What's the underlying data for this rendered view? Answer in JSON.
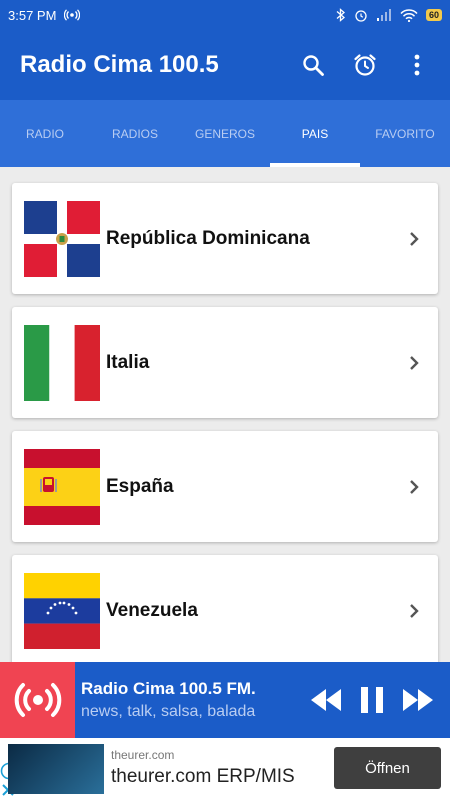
{
  "status_bar": {
    "time": "3:57 PM",
    "battery": "60"
  },
  "app_bar": {
    "title": "Radio Cima 100.5",
    "icons": [
      "search-icon",
      "alarm-icon",
      "more-vert-icon"
    ]
  },
  "tabs": [
    {
      "label": "RADIO"
    },
    {
      "label": "RADIOS"
    },
    {
      "label": "GENEROS"
    },
    {
      "label": "PAIS",
      "active": true
    },
    {
      "label": "FAVORITO"
    }
  ],
  "countries": [
    {
      "name": "República Dominicana",
      "flag": "dominican-republic-flag"
    },
    {
      "name": "Italia",
      "flag": "italy-flag"
    },
    {
      "name": "España",
      "flag": "spain-flag"
    },
    {
      "name": "Venezuela",
      "flag": "venezuela-flag"
    }
  ],
  "player": {
    "title": "Radio Cima 100.5 FM.",
    "subtitle": "news, talk, salsa, balada",
    "state": "playing"
  },
  "ad": {
    "domain": "theurer.com",
    "headline": "theurer.com ERP/MIS",
    "button_label": "Öffnen"
  },
  "colors": {
    "primary": "#1b5cc8",
    "tab_bar": "#2f6fd8",
    "accent": "#f04452",
    "ad_button": "#3f3f3f"
  }
}
